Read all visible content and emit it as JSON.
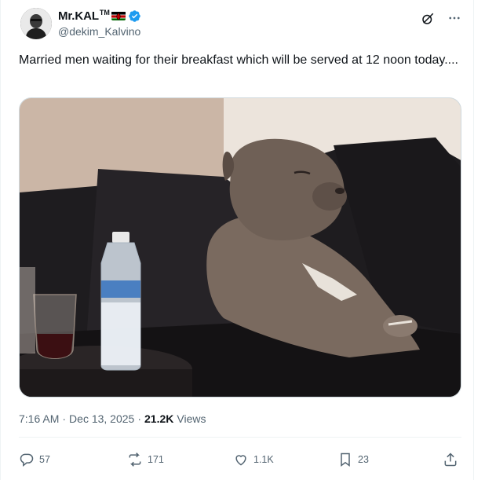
{
  "author": {
    "display_name": "Mr.KAL",
    "tm": "TM",
    "handle": "@dekim_Kalvino"
  },
  "tweet": {
    "text": "Married men waiting for their breakfast which will be served at 12 noon today...."
  },
  "meta": {
    "time": "7:16 AM",
    "separator": "·",
    "date": "Dec 13, 2025",
    "views_count": "21.2K",
    "views_label": "Views"
  },
  "actions": {
    "replies": "57",
    "reposts": "171",
    "likes": "1.1K",
    "bookmarks": "23"
  },
  "icons": {
    "verified": "verified-badge-icon",
    "grok": "grok-icon",
    "more": "more-icon",
    "reply": "reply-icon",
    "repost": "repost-icon",
    "like": "like-icon",
    "bookmark": "bookmark-icon",
    "share": "share-icon"
  },
  "colors": {
    "verified_blue": "#1d9bf0",
    "secondary_text": "#536471",
    "primary_text": "#0f1419"
  }
}
